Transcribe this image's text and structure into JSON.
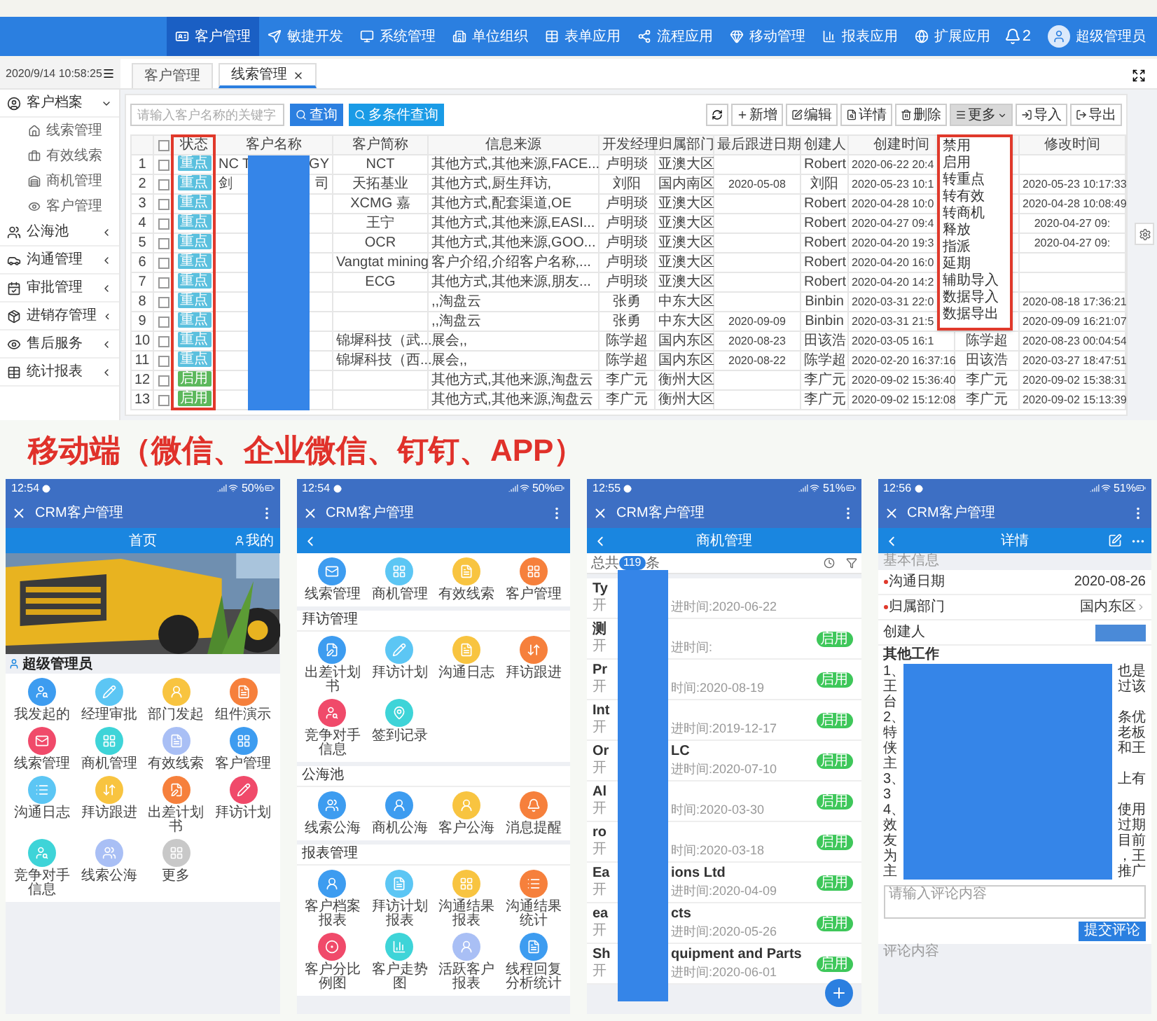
{
  "desktop": {
    "nav": {
      "items": [
        {
          "label": "客户管理",
          "selected": true
        },
        {
          "label": "敏捷开发",
          "selected": false
        },
        {
          "label": "系统管理",
          "selected": false
        },
        {
          "label": "单位组织",
          "selected": false
        },
        {
          "label": "表单应用",
          "selected": false
        },
        {
          "label": "流程应用",
          "selected": false
        },
        {
          "label": "移动管理",
          "selected": false
        },
        {
          "label": "报表应用",
          "selected": false
        },
        {
          "label": "扩展应用",
          "selected": false
        }
      ],
      "notifications": "2",
      "user": "超级管理员"
    },
    "datetime": "2020/9/14 10:58:25",
    "tabs": [
      {
        "label": "客户管理",
        "selected": false,
        "closable": false
      },
      {
        "label": "线索管理",
        "selected": true,
        "closable": true
      }
    ],
    "sidebar": [
      {
        "label": "客户档案",
        "expanded": true,
        "children": [
          {
            "label": "线索管理"
          },
          {
            "label": "有效线索"
          },
          {
            "label": "商机管理"
          },
          {
            "label": "客户管理"
          }
        ]
      },
      {
        "label": "公海池",
        "expanded": false
      },
      {
        "label": "沟通管理",
        "expanded": false
      },
      {
        "label": "审批管理",
        "expanded": false
      },
      {
        "label": "进销存管理",
        "expanded": false
      },
      {
        "label": "售后服务",
        "expanded": false
      },
      {
        "label": "统计报表",
        "expanded": false
      }
    ],
    "search": {
      "placeholder": "请输入客户名称的关键字"
    },
    "search_buttons": [
      "查询",
      "多条件查询"
    ],
    "toolbar": [
      {
        "label": "新增",
        "selected": false
      },
      {
        "label": "编辑",
        "selected": false
      },
      {
        "label": "详情",
        "selected": false
      },
      {
        "label": "删除",
        "selected": false
      },
      {
        "label": "更多",
        "selected": true
      },
      {
        "label": "导入",
        "selected": false
      },
      {
        "label": "导出",
        "selected": false
      }
    ],
    "more_menu": {
      "open": true,
      "items": [
        "禁用",
        "启用",
        "转重点",
        "转有效",
        "转商机",
        "释放",
        "指派",
        "延期",
        "辅助导入",
        "数据导入",
        "数据导出"
      ]
    },
    "table": {
      "header_checked": false,
      "columns": {
        "status": "状态",
        "name": "客户名称",
        "short_name": "客户简称",
        "source": "信息来源",
        "manager": "开发经理",
        "department": "归属部门",
        "last_follow_up": "最后跟进日期",
        "creator": "创建人",
        "created": "创建时间",
        "modified": "修改时间"
      },
      "rows": [
        {
          "index": "1",
          "checked": false,
          "status": {
            "label": "重点",
            "kind": "key"
          },
          "name_start": "NC T",
          "name_end": "GY",
          "short_name": "NCT",
          "source": "其他方式,其他来源,FACE...",
          "manager": "卢明琰",
          "department": "亚澳大区",
          "creator": "Robert",
          "created": "2020-06-22 20:4"
        },
        {
          "index": "2",
          "checked": false,
          "status": {
            "label": "重点",
            "kind": "key"
          },
          "name_start": "剑",
          "name_end": "司",
          "short_name": "天拓基业",
          "source": "其他方式,厨生拜访,",
          "manager": "刘阳",
          "department": "国内南区",
          "last_follow_up": "2020-05-08",
          "creator": "刘阳",
          "created": "2020-05-23 10:1",
          "modified": "2020-05-23 10:17:33"
        },
        {
          "index": "3",
          "checked": false,
          "status": {
            "label": "重点",
            "kind": "key"
          },
          "short_name": "XCMG 嘉",
          "source": "其他方式,配套渠道,OE",
          "manager": "卢明琰",
          "department": "亚澳大区",
          "creator": "Robert",
          "created": "2020-04-28 10:0",
          "modified": "2020-04-28 10:08:49"
        },
        {
          "index": "4",
          "checked": false,
          "status": {
            "label": "重点",
            "kind": "key"
          },
          "short_name": "王宁",
          "source": "其他方式,其他来源,EASI...",
          "manager": "卢明琰",
          "department": "亚澳大区",
          "creator": "Robert",
          "created": "2020-04-27 09:4",
          "modified": "2020-04-27 09:"
        },
        {
          "index": "5",
          "checked": false,
          "status": {
            "label": "重点",
            "kind": "key"
          },
          "short_name": "OCR",
          "source": "其他方式,其他来源,GOO...",
          "manager": "卢明琰",
          "department": "亚澳大区",
          "creator": "Robert",
          "created": "2020-04-20 19:3",
          "modified": "2020-04-27 09:"
        },
        {
          "index": "6",
          "checked": false,
          "status": {
            "label": "重点",
            "kind": "key"
          },
          "short_name": "Vangtat mining",
          "source": "客户介绍,介绍客户名称,...",
          "manager": "卢明琰",
          "department": "亚澳大区",
          "creator": "Robert",
          "created": "2020-04-20 16:0"
        },
        {
          "index": "7",
          "checked": false,
          "status": {
            "label": "重点",
            "kind": "key"
          },
          "short_name": "ECG",
          "source": "其他方式,其他来源,朋友...",
          "manager": "卢明琰",
          "department": "亚澳大区",
          "creator": "Robert",
          "created": "2020-04-20 14:2"
        },
        {
          "index": "8",
          "checked": false,
          "status": {
            "label": "重点",
            "kind": "key"
          },
          "source": ",,淘盘云",
          "manager": "张勇",
          "department": "中东大区",
          "creator": "Binbin",
          "created": "2020-03-31 22:0",
          "modified": "2020-08-18 17:36:21"
        },
        {
          "index": "9",
          "checked": false,
          "status": {
            "label": "重点",
            "kind": "key"
          },
          "source": ",,淘盘云",
          "manager": "张勇",
          "department": "中东大区",
          "last_follow_up": "2020-09-09",
          "creator": "Binbin",
          "created": "2020-03-31 21:5",
          "modified": "2020-09-09 16:21:07"
        },
        {
          "index": "10",
          "checked": false,
          "status": {
            "label": "重点",
            "kind": "key"
          },
          "short_name": "锦墀科技（武...",
          "source": "展会,,",
          "manager": "陈学超",
          "department": "国内东区",
          "last_follow_up": "2020-08-23",
          "creator": "田该浩",
          "created": "2020-03-05 16:1",
          "column_12": "陈学超",
          "modified": "2020-08-23 00:04:54"
        },
        {
          "index": "11",
          "checked": false,
          "status": {
            "label": "重点",
            "kind": "key"
          },
          "short_name": "锦墀科技（西...",
          "source": "展会,,",
          "manager": "陈学超",
          "department": "国内东区",
          "last_follow_up": "2020-08-22",
          "creator": "陈学超",
          "created": "2020-02-20 16:37:16",
          "column_12": "田该浩",
          "modified": "2020-03-27 18:47:51"
        },
        {
          "index": "12",
          "checked": false,
          "status": {
            "label": "启用",
            "kind": "enabled"
          },
          "source": "其他方式,其他来源,淘盘云",
          "manager": "李广元",
          "department": "衡州大区",
          "creator": "李广元",
          "created": "2020-09-02 15:36:40",
          "column_12": "李广元",
          "modified": "2020-09-02 15:38:31"
        },
        {
          "index": "13",
          "checked": false,
          "status": {
            "label": "启用",
            "kind": "enabled"
          },
          "source": "其他方式,其他来源,淘盘云",
          "manager": "李广元",
          "department": "衡州大区",
          "creator": "李广元",
          "created": "2020-09-02 15:12:08",
          "column_12": "李广元",
          "modified": "2020-09-02 15:13:39"
        }
      ]
    }
  },
  "mobile": {
    "heading": "移动端（微信、企业微信、钉钉、APP）",
    "phones": [
      {
        "kind": "home",
        "time": "12:54",
        "battery": "50%",
        "app_title": "CRM客户管理",
        "page_title": "首页",
        "account": "我的",
        "user": "超级管理员",
        "apps": [
          {
            "label": "我发起的",
            "color": "#3d9cf0"
          },
          {
            "label": "经理审批",
            "color": "#5cc6f4"
          },
          {
            "label": "部门发起",
            "color": "#f8c440"
          },
          {
            "label": "组件演示",
            "color": "#f6803c"
          },
          {
            "label": "线索管理",
            "color": "#f04a6a"
          },
          {
            "label": "商机管理",
            "color": "#3ed4d8"
          },
          {
            "label": "有效线索",
            "color": "#a9bff5"
          },
          {
            "label": "客户管理",
            "color": "#3d9cf0"
          },
          {
            "label": "沟通日志",
            "color": "#5cc6f4"
          },
          {
            "label": "拜访跟进",
            "color": "#f8c440"
          },
          {
            "label": "出差计划书",
            "color": "#f6803c"
          },
          {
            "label": "拜访计划",
            "color": "#f04a6a"
          },
          {
            "label": "竞争对手信息",
            "color": "#3ed4d8"
          },
          {
            "label": "线索公海",
            "color": "#a9bff5"
          },
          {
            "label": "更多",
            "color": "#c8c8c8"
          }
        ]
      },
      {
        "kind": "menu",
        "time": "12:54",
        "battery": "50%",
        "app_title": "CRM客户管理",
        "sections": [
          {
            "apps": [
              {
                "label": "线索管理",
                "color": "#3d9cf0"
              },
              {
                "label": "商机管理",
                "color": "#5cc6f4"
              },
              {
                "label": "有效线索",
                "color": "#f8c440"
              },
              {
                "label": "客户管理",
                "color": "#f6803c"
              }
            ]
          },
          {
            "title": "拜访管理",
            "apps": [
              {
                "label": "出差计划书",
                "color": "#3d9cf0"
              },
              {
                "label": "拜访计划",
                "color": "#5cc6f4"
              },
              {
                "label": "沟通日志",
                "color": "#f8c440"
              },
              {
                "label": "拜访跟进",
                "color": "#f6803c"
              },
              {
                "label": "竞争对手信息",
                "color": "#f04a6a"
              },
              {
                "label": "签到记录",
                "color": "#3ed4d8"
              }
            ]
          },
          {
            "title": "公海池",
            "apps": [
              {
                "label": "线索公海",
                "color": "#3d9cf0"
              },
              {
                "label": "商机公海",
                "color": "#3d9cf0"
              },
              {
                "label": "客户公海",
                "color": "#f8c440"
              },
              {
                "label": "消息提醒",
                "color": "#f6803c"
              }
            ]
          },
          {
            "title": "报表管理",
            "apps": [
              {
                "label": "客户档案报表",
                "color": "#3d9cf0"
              },
              {
                "label": "拜访计划报表",
                "color": "#5cc6f4"
              },
              {
                "label": "沟通结果报表",
                "color": "#f8c440"
              },
              {
                "label": "沟通结果统计",
                "color": "#f6803c"
              },
              {
                "label": "客户分比例图",
                "color": "#f04a6a"
              },
              {
                "label": "客户走势图",
                "color": "#3ed4d8"
              },
              {
                "label": "活跃客户报表",
                "color": "#a9bff5"
              },
              {
                "label": "线程回复分析统计",
                "color": "#3d9cf0"
              }
            ]
          }
        ]
      },
      {
        "kind": "list",
        "time": "12:55",
        "battery": "51%",
        "app_title": "CRM客户管理",
        "page_title": "商机管理",
        "total_prefix": "总共",
        "total": "119",
        "total_suffix": "条",
        "items": [
          {
            "title_start": "Ty",
            "line_start": "开",
            "line_end": "进时间:2020-06-22"
          },
          {
            "title_start": "测",
            "line_start": "开",
            "line_end": "进时间:",
            "badge": "启用"
          },
          {
            "title_start": "Pr",
            "line_start": "开",
            "line_end": "时间:2020-08-19",
            "badge": "启用"
          },
          {
            "title_start": "Int",
            "line_start": "开",
            "line_end": "进时间:2019-12-17",
            "badge": "启用"
          },
          {
            "title_start": "Or",
            "title_end": "LC",
            "line_start": "开",
            "line_end": "进时间:2020-07-10",
            "badge": "启用"
          },
          {
            "title_start": "Al",
            "line_start": "开",
            "line_end": "时间:2020-03-30",
            "badge": "启用"
          },
          {
            "title_start": "ro",
            "line_start": "开",
            "line_end": "时间:2020-03-18",
            "badge": "启用"
          },
          {
            "title_start": "Ea",
            "title_end": "ions Ltd",
            "line_start": "开",
            "line_end": "进时间:2020-04-09",
            "badge": "启用"
          },
          {
            "title_start": "ea",
            "title_end": "cts",
            "line_start": "开",
            "line_end": "进时间:2020-05-26",
            "badge": "启用"
          },
          {
            "title_start": "Sh",
            "title_end": "quipment and Parts",
            "line_start": "开",
            "line_end": "进时间:2020-06-01",
            "badge": "启用"
          }
        ]
      },
      {
        "kind": "detail",
        "time": "12:56",
        "battery": "51%",
        "app_title": "CRM客户管理",
        "page_title": "详情",
        "section": "基本信息",
        "fields": [
          {
            "label": "沟通日期",
            "required": true,
            "kind": "text",
            "value": "2020-08-26"
          },
          {
            "label": "归属部门",
            "required": true,
            "kind": "select",
            "value": "国内东区"
          },
          {
            "label": "创建人",
            "required": false,
            "kind": "redacted"
          }
        ],
        "other_title": "其他工作",
        "lines": [
          [
            "1、",
            "也是"
          ],
          [
            "王",
            "过该"
          ],
          [
            "台"
          ],
          [
            "2、",
            "条优"
          ],
          [
            "特",
            "老板"
          ],
          [
            "侠",
            "和王"
          ],
          [
            "主"
          ],
          [
            "3、",
            "上有"
          ],
          [
            "3"
          ],
          [
            "4、",
            "使用"
          ],
          [
            "效",
            "过期"
          ],
          [
            "友",
            "目前"
          ],
          [
            "为",
            "，王"
          ],
          [
            "主",
            "推广"
          ]
        ],
        "comment_placeholder": "请输入评论内容",
        "submit": "提交评论",
        "comments_title": "评论内容"
      }
    ]
  }
}
